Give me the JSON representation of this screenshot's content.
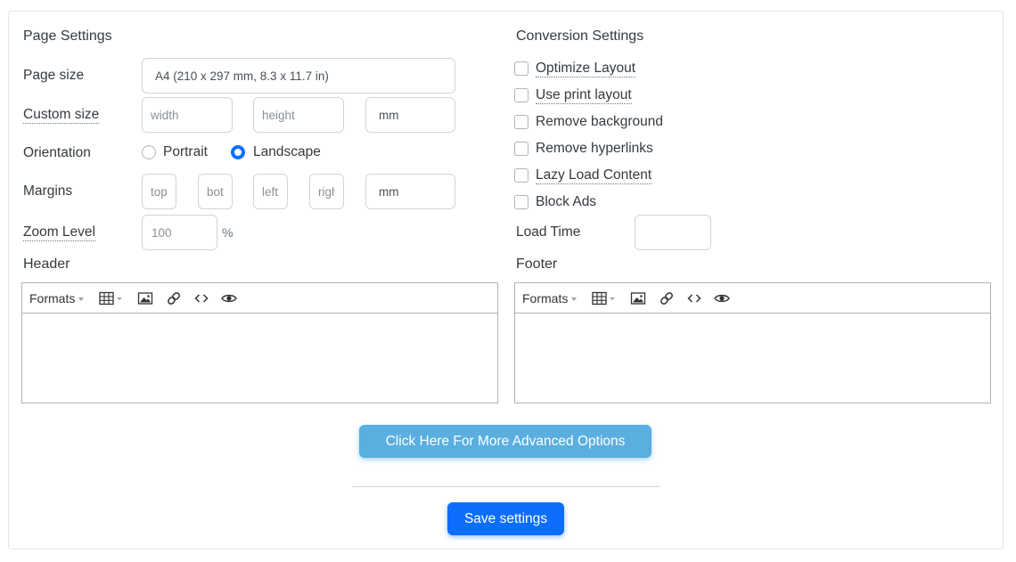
{
  "page_settings": {
    "title": "Page Settings",
    "page_size": {
      "label": "Page size",
      "value": "A4 (210 x 297 mm, 8.3 x 11.7 in)"
    },
    "custom_size": {
      "label": "Custom size",
      "width_placeholder": "width",
      "height_placeholder": "height",
      "unit": "mm"
    },
    "orientation": {
      "label": "Orientation",
      "options": [
        "Portrait",
        "Landscape"
      ],
      "selected": "Landscape"
    },
    "margins": {
      "label": "Margins",
      "top_placeholder": "top",
      "bottom_placeholder": "bottom",
      "left_placeholder": "left",
      "right_placeholder": "right",
      "unit": "mm"
    },
    "zoom": {
      "label": "Zoom Level",
      "placeholder": "100",
      "unit": "%"
    }
  },
  "conversion_settings": {
    "title": "Conversion Settings",
    "options": [
      {
        "label": "Optimize Layout",
        "checked": false
      },
      {
        "label": "Use print layout",
        "checked": false
      },
      {
        "label": "Remove background",
        "checked": false
      },
      {
        "label": "Remove hyperlinks",
        "checked": false
      },
      {
        "label": "Lazy Load Content",
        "checked": false
      },
      {
        "label": "Block Ads",
        "checked": false
      }
    ],
    "load_time": {
      "label": "Load Time",
      "value": ""
    }
  },
  "header": {
    "title": "Header",
    "toolbar": {
      "formats_label": "Formats"
    }
  },
  "footer": {
    "title": "Footer",
    "toolbar": {
      "formats_label": "Formats"
    }
  },
  "icons": [
    "table-icon",
    "image-icon",
    "link-icon",
    "code-icon",
    "preview-icon"
  ],
  "buttons": {
    "advanced": "Click Here For More Advanced Options",
    "save": "Save settings"
  },
  "colors": {
    "primary": "#0d6efd",
    "info": "#5aaee0"
  }
}
